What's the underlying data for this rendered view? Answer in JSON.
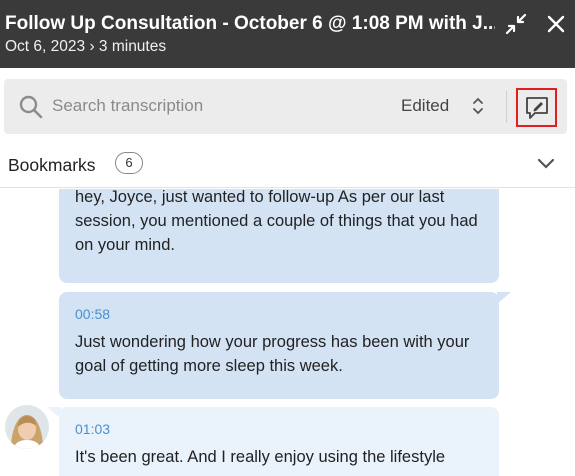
{
  "header": {
    "title": "Follow Up Consultation - October 6 @ 1:08 PM with J...",
    "subtitle": "Oct 6, 2023 › 3 minutes"
  },
  "search": {
    "placeholder": "Search transcription",
    "filter_label": "Edited"
  },
  "bookmarks": {
    "label": "Bookmarks",
    "count": "6"
  },
  "messages": [
    {
      "speaker": "me",
      "time": "",
      "text": "hey, Joyce, just wanted to follow-up As per our last session, you mentioned a couple of things that you had on your mind."
    },
    {
      "speaker": "me",
      "time": "00:58",
      "text": "Just wondering how your progress has been with your goal of getting more sleep this week."
    },
    {
      "speaker": "client",
      "time": "01:03",
      "text": "It's been great.  And I really enjoy using the lifestyle"
    }
  ],
  "colors": {
    "header_bg": "#3a3a3a",
    "outgoing_bubble": "#d3e3f4",
    "incoming_bubble": "#eaf2fb",
    "timestamp": "#4a8fd1",
    "highlight_border": "#e02020"
  }
}
